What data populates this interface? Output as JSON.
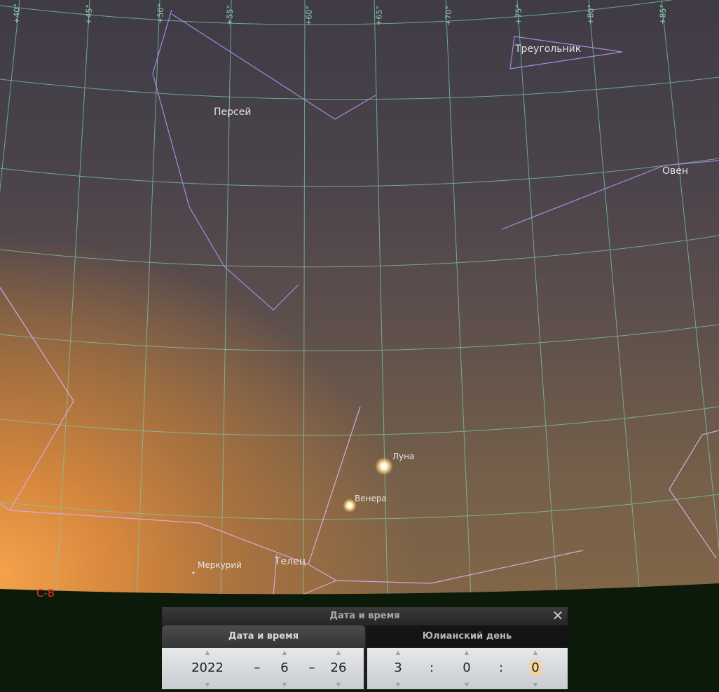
{
  "sky": {
    "ra_labels": [
      "+40°",
      "+45°",
      "+50°",
      "+55°",
      "+60°",
      "+65°",
      "+70°",
      "+75°",
      "+80°",
      "+85°"
    ],
    "constellations": [
      "Треугольник",
      "Персей",
      "Овен",
      "Телец"
    ],
    "objects": [
      "Луна",
      "Венера",
      "Меркурий"
    ],
    "cardinal": "С-В",
    "colors": {
      "grid": "#7ec8a8",
      "constellation_lines": "#a58be0",
      "cardinal": "#e0342c",
      "ground": "#0c1a0a"
    }
  },
  "dialog": {
    "title": "Дата и время",
    "close_icon": "close-icon",
    "tabs": [
      {
        "label": "Дата и время",
        "active": true
      },
      {
        "label": "Юлианский день",
        "active": false
      }
    ],
    "date": {
      "year": "2022",
      "month": "6",
      "day": "26",
      "sep": "–"
    },
    "time": {
      "hour": "3",
      "minute": "0",
      "second": "0",
      "sep": ":"
    }
  }
}
